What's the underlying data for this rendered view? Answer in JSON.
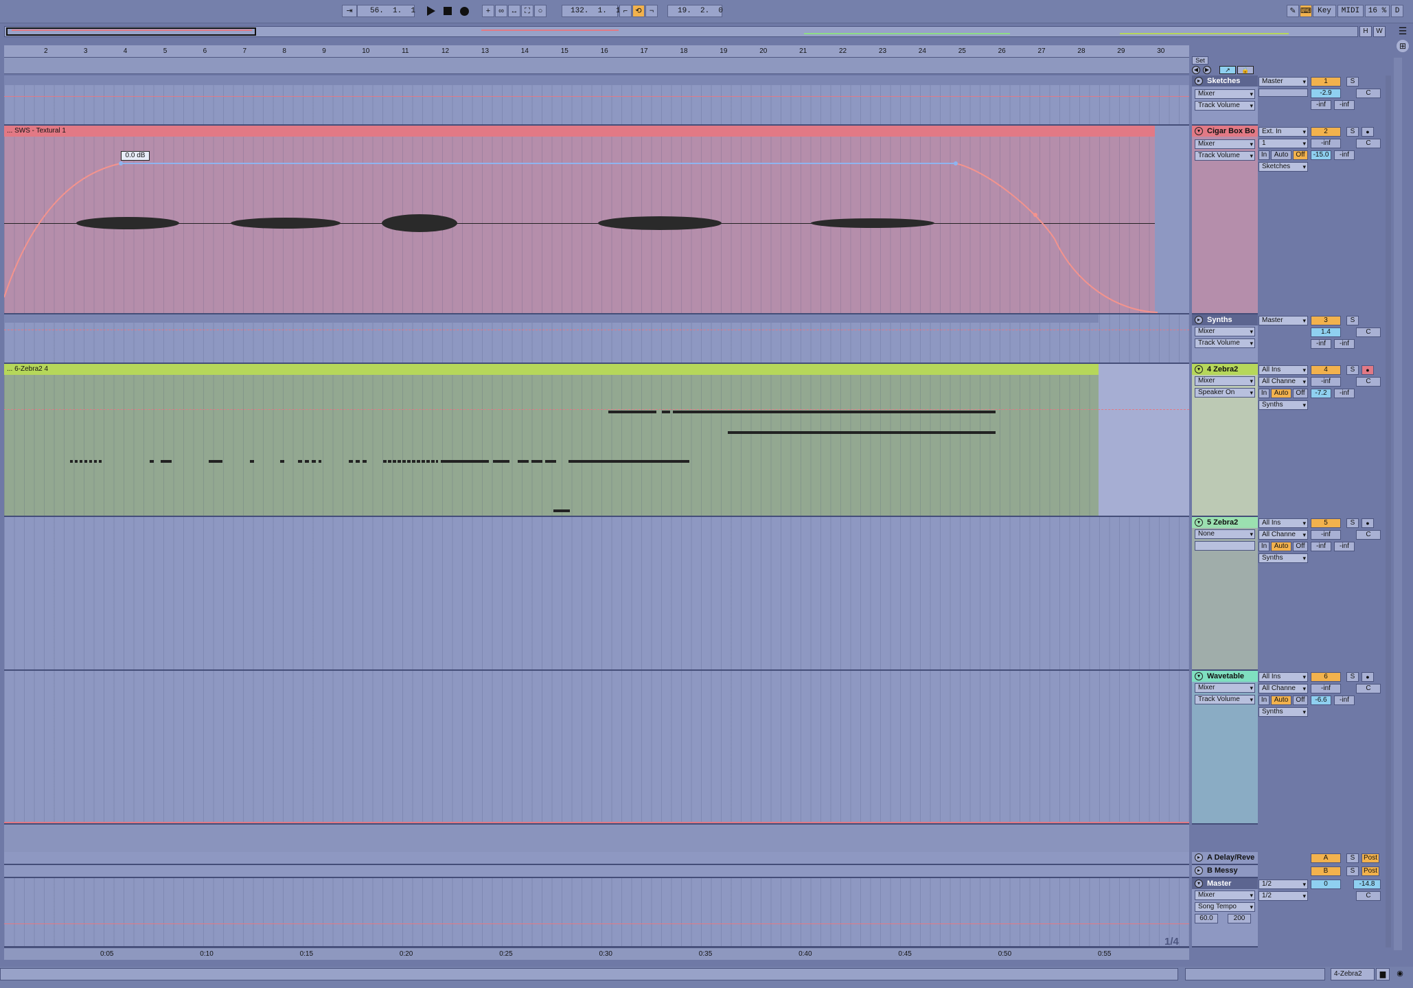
{
  "transport": {
    "arrangement_position": "56.  1.  1",
    "loop_start": "132.  1.  1",
    "loop_length": "19.  2.  0",
    "key_label": "Key",
    "midi_label": "MIDI",
    "cpu": "16 %",
    "d_label": "D"
  },
  "overview": {
    "h_label": "H",
    "w_label": "W"
  },
  "ruler": {
    "bars": [
      "2",
      "3",
      "4",
      "5",
      "6",
      "7",
      "8",
      "9",
      "10",
      "11",
      "12",
      "13",
      "14",
      "15",
      "16",
      "17",
      "18",
      "19",
      "20",
      "21",
      "22",
      "23",
      "24",
      "25",
      "26",
      "27",
      "28",
      "29",
      "30"
    ],
    "set_label": "Set"
  },
  "time_ruler": {
    "ticks": [
      "0:05",
      "0:10",
      "0:15",
      "0:20",
      "0:25",
      "0:30",
      "0:35",
      "0:40",
      "0:45",
      "0:50",
      "0:55"
    ]
  },
  "page_indicator": "1/4",
  "tracks": [
    {
      "name": "Sketches",
      "device": "Mixer",
      "param": "Track Volume",
      "output": "Master",
      "number": "1",
      "solo": "S",
      "volume": "-2.9",
      "pan": "C",
      "send_a": "-inf",
      "send_b": "-inf"
    },
    {
      "name": "Cigar Box Bo",
      "clip": "... SWS - Textural 1",
      "automation_label": "0.0 dB",
      "device": "Mixer",
      "param": "Track Volume",
      "input": "Ext. In",
      "input_channel": "1",
      "monitor_in": "In",
      "monitor_auto": "Auto",
      "monitor_off": "Off",
      "output": "Sketches",
      "number": "2",
      "solo": "S",
      "volume": "-inf",
      "pan": "C",
      "send_a": "-15.0",
      "send_b": "-inf"
    },
    {
      "name": "Synths",
      "device": "Mixer",
      "param": "Track Volume",
      "output": "Master",
      "number": "3",
      "solo": "S",
      "volume": "1.4",
      "pan": "C",
      "send_a": "-inf",
      "send_b": "-inf"
    },
    {
      "name": "4 Zebra2",
      "clip": "... 6-Zebra2 4",
      "device": "Mixer",
      "param": "Speaker On",
      "input": "All Ins",
      "input_channel": "All Channe",
      "monitor_in": "In",
      "monitor_auto": "Auto",
      "monitor_off": "Off",
      "output": "Synths",
      "number": "4",
      "solo": "S",
      "volume": "-inf",
      "pan": "C",
      "send_a": "-7.2",
      "send_b": "-inf"
    },
    {
      "name": "5 Zebra2",
      "device": "None",
      "input": "All Ins",
      "input_channel": "All Channe",
      "monitor_in": "In",
      "monitor_auto": "Auto",
      "monitor_off": "Off",
      "output": "Synths",
      "number": "5",
      "solo": "S",
      "volume": "-inf",
      "pan": "C",
      "send_a": "-inf",
      "send_b": "-inf"
    },
    {
      "name": "Wavetable",
      "device": "Mixer",
      "param": "Track Volume",
      "input": "All Ins",
      "input_channel": "All Channe",
      "monitor_in": "In",
      "monitor_auto": "Auto",
      "monitor_off": "Off",
      "output": "Synths",
      "number": "6",
      "solo": "S",
      "volume": "-inf",
      "pan": "C",
      "send_a": "-6.6",
      "send_b": "-inf"
    }
  ],
  "returns": [
    {
      "name": "A Delay/Reve",
      "number": "A",
      "solo": "S",
      "post": "Post"
    },
    {
      "name": "B Messy",
      "number": "B",
      "solo": "S",
      "post": "Post"
    }
  ],
  "master": {
    "name": "Master",
    "device": "Mixer",
    "param": "Song Tempo",
    "tempo_min": "60.0",
    "tempo_max": "200",
    "out1": "1/2",
    "out2": "1/2",
    "number": "0",
    "volume": "-14.8",
    "pan": "C"
  },
  "status": {
    "selected_track": "4-Zebra2"
  },
  "colors": {
    "sketches": "#5c6590",
    "cigar": "#e27985",
    "synths": "#5c6590",
    "zebra4": "#b6d75a",
    "zebra5": "#9be0b0",
    "wavetable": "#7fdfc0",
    "accent": "#f2b24d"
  }
}
